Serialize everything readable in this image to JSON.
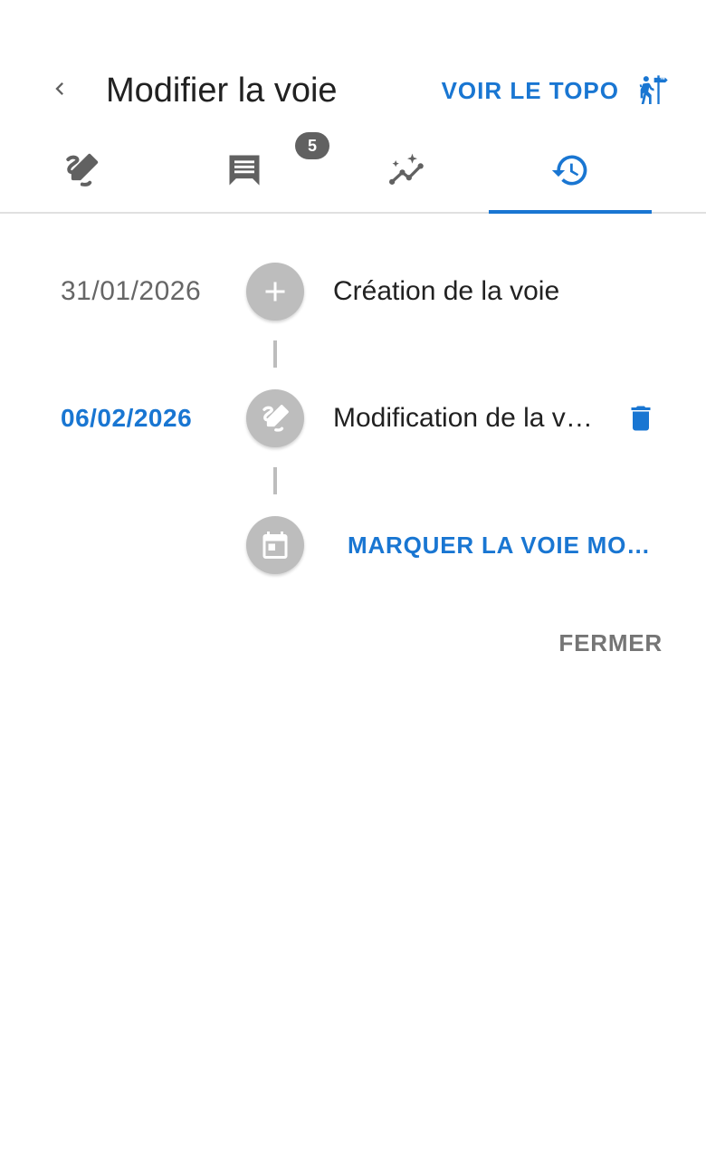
{
  "header": {
    "title": "Modifier la voie",
    "topo_link_label": "VOIR LE TOPO",
    "back_icon": "chevron-left-icon",
    "topo_icon": "hiker-signpost-icon"
  },
  "tabs": [
    {
      "name": "edit",
      "icon": "edit-route-icon",
      "active": false
    },
    {
      "name": "comments",
      "icon": "comment-icon",
      "badge": "5",
      "active": false
    },
    {
      "name": "stats",
      "icon": "sparkle-chart-icon",
      "active": false
    },
    {
      "name": "history",
      "icon": "history-icon",
      "active": true
    }
  ],
  "timeline": {
    "events": [
      {
        "date": "31/01/2026",
        "text": "Création de la voie",
        "icon": "plus-icon"
      },
      {
        "date": "06/02/2026",
        "text": "Modification de la voie",
        "icon": "edit-route-icon",
        "deletable": true
      }
    ],
    "action": {
      "label": "MARQUER LA VOIE MODIFIÉE",
      "icon": "calendar-icon"
    }
  },
  "footer": {
    "close_label": "FERMER"
  },
  "colors": {
    "accent": "#1976d2",
    "icon_gray": "#616161",
    "dot_gray": "#bdbdbd",
    "muted_text": "#757575"
  }
}
